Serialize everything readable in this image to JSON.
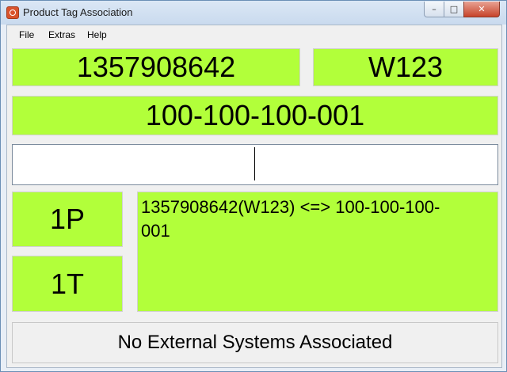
{
  "window": {
    "title": "Product Tag Association"
  },
  "controls": {
    "minimize": "–",
    "maximize": "□",
    "close": "✕"
  },
  "menu": {
    "items": [
      "File",
      "Extras",
      "Help"
    ]
  },
  "fields": {
    "product_id": "1357908642",
    "location": "W123",
    "tag_id": "100-100-100-001",
    "input_value": ""
  },
  "mode_buttons": {
    "first": "1P",
    "second": "1T"
  },
  "association": {
    "text": "1357908642(W123) <=> 100-100-100-001"
  },
  "status": {
    "text": "No External Systems Associated"
  },
  "colors": {
    "panel_green": "#b2ff3a",
    "background": "#f0f0f0"
  }
}
